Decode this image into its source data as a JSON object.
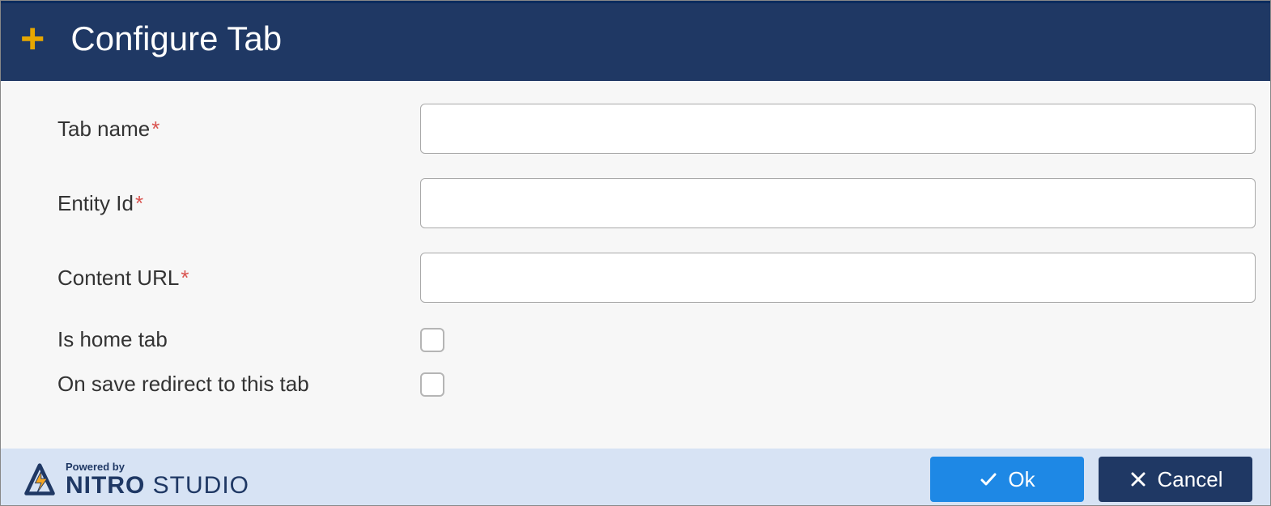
{
  "header": {
    "title": "Configure Tab"
  },
  "form": {
    "tab_name": {
      "label": "Tab name",
      "required": true,
      "value": ""
    },
    "entity_id": {
      "label": "Entity Id",
      "required": true,
      "value": ""
    },
    "content_url": {
      "label": "Content URL",
      "required": true,
      "value": ""
    },
    "is_home_tab": {
      "label": "Is home tab",
      "checked": false
    },
    "on_save_redirect": {
      "label": "On save redirect to this tab",
      "checked": false
    }
  },
  "footer": {
    "powered_by": "Powered by",
    "brand_bold": "NITRO",
    "brand_light": " STUDIO",
    "ok_label": "Ok",
    "cancel_label": "Cancel"
  },
  "required_mark": "*",
  "colors": {
    "header_bg": "#1f3864",
    "accent_ok": "#1e88e5",
    "accent_cancel": "#1f3864",
    "plus_icon": "#e6a700",
    "footer_bg": "#d7e3f4"
  }
}
